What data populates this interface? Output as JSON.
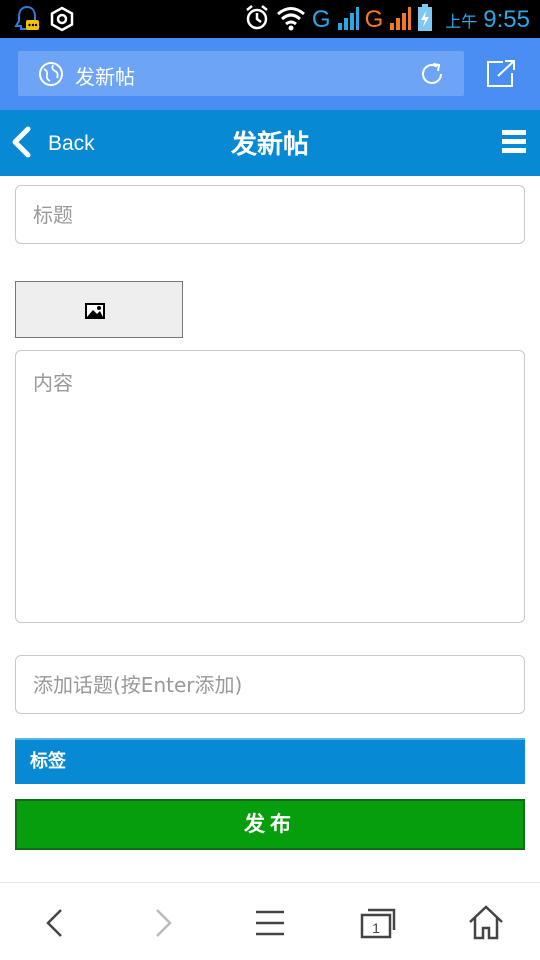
{
  "status_bar": {
    "network_label_1": "G",
    "network_label_2": "G",
    "sim_1": "1",
    "sim_2": "2",
    "ampm": "上午",
    "time": "9:55"
  },
  "browser": {
    "url_text": "发新帖",
    "icons": [
      "globe-icon",
      "reload-icon",
      "share-icon"
    ]
  },
  "header": {
    "back_label": "Back",
    "title": "发新帖",
    "icons": [
      "chevron-left-icon",
      "hamburger-menu-icon"
    ]
  },
  "form": {
    "title_placeholder": "标题",
    "image_button_icon": "image-icon",
    "content_placeholder": "内容",
    "topic_placeholder": "添加话题(按Enter添加)",
    "tags_label": "标签",
    "publish_label": "发布"
  },
  "bottom_nav": {
    "items": [
      "back-arrow-icon",
      "forward-arrow-icon",
      "menu-icon",
      "tabs-icon",
      "home-icon"
    ],
    "tab_count": "1"
  },
  "colors": {
    "status_bar": "#000000",
    "browser_bar": "#4a8ef4",
    "app_header": "#0789d4",
    "tag_bar": "#0789d4",
    "publish_button": "#069e0d"
  }
}
